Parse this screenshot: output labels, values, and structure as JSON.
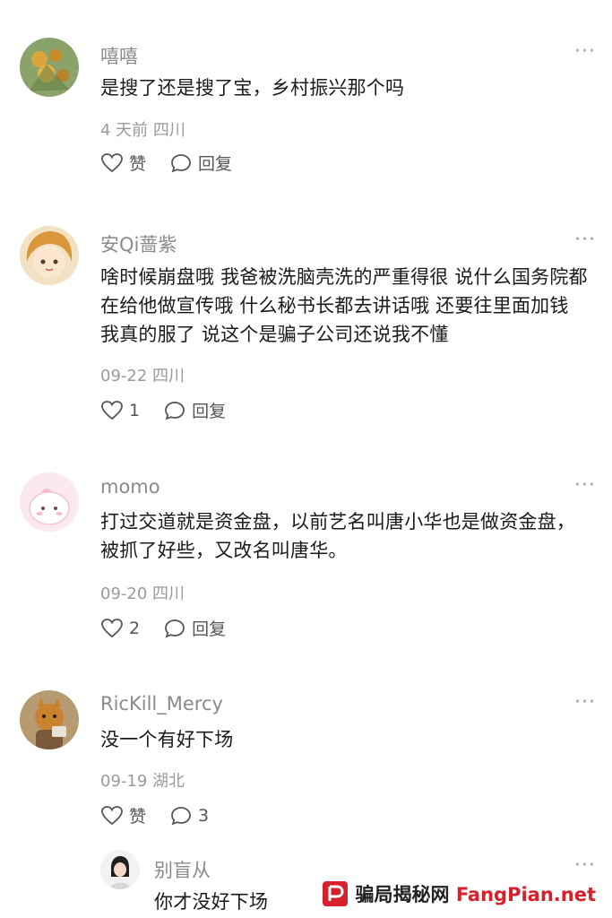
{
  "comments": [
    {
      "username": "嘻嘻",
      "text": "是搜了还是搜了宝，乡村振兴那个吗",
      "meta": "4 天前 四川",
      "like_label": "赞",
      "reply_label": "回复",
      "more": "···"
    },
    {
      "username": "安Qi蔷紫",
      "text": "啥时候崩盘哦 我爸被洗脑壳洗的严重得很 说什么国务院都在给他做宣传哦 什么秘书长都去讲话哦 还要往里面加钱 我真的服了 说这个是骗子公司还说我不懂",
      "meta": "09-22 四川",
      "like_label": "1",
      "reply_label": "回复",
      "more": "···"
    },
    {
      "username": "momo",
      "text": "打过交道就是资金盘，以前艺名叫唐小华也是做资金盘，被抓了好些，又改名叫唐华。",
      "meta": "09-20 四川",
      "like_label": "2",
      "reply_label": "回复",
      "more": "···"
    },
    {
      "username": "RicKill_Mercy",
      "text": "没一个有好下场",
      "meta": "09-19 湖北",
      "like_label": "赞",
      "reply_label": "3",
      "more": "···"
    }
  ],
  "reply": {
    "username": "别盲从",
    "text": "你才没好下场",
    "more": "···"
  },
  "watermark": {
    "text_cn": "骗局揭秘网",
    "text_en": "FangPian.net",
    "brand_color": "#d6202b"
  },
  "icons": {
    "like": "heart-outline-icon",
    "reply": "speech-bubble-icon",
    "more": "more-dots-icon"
  }
}
